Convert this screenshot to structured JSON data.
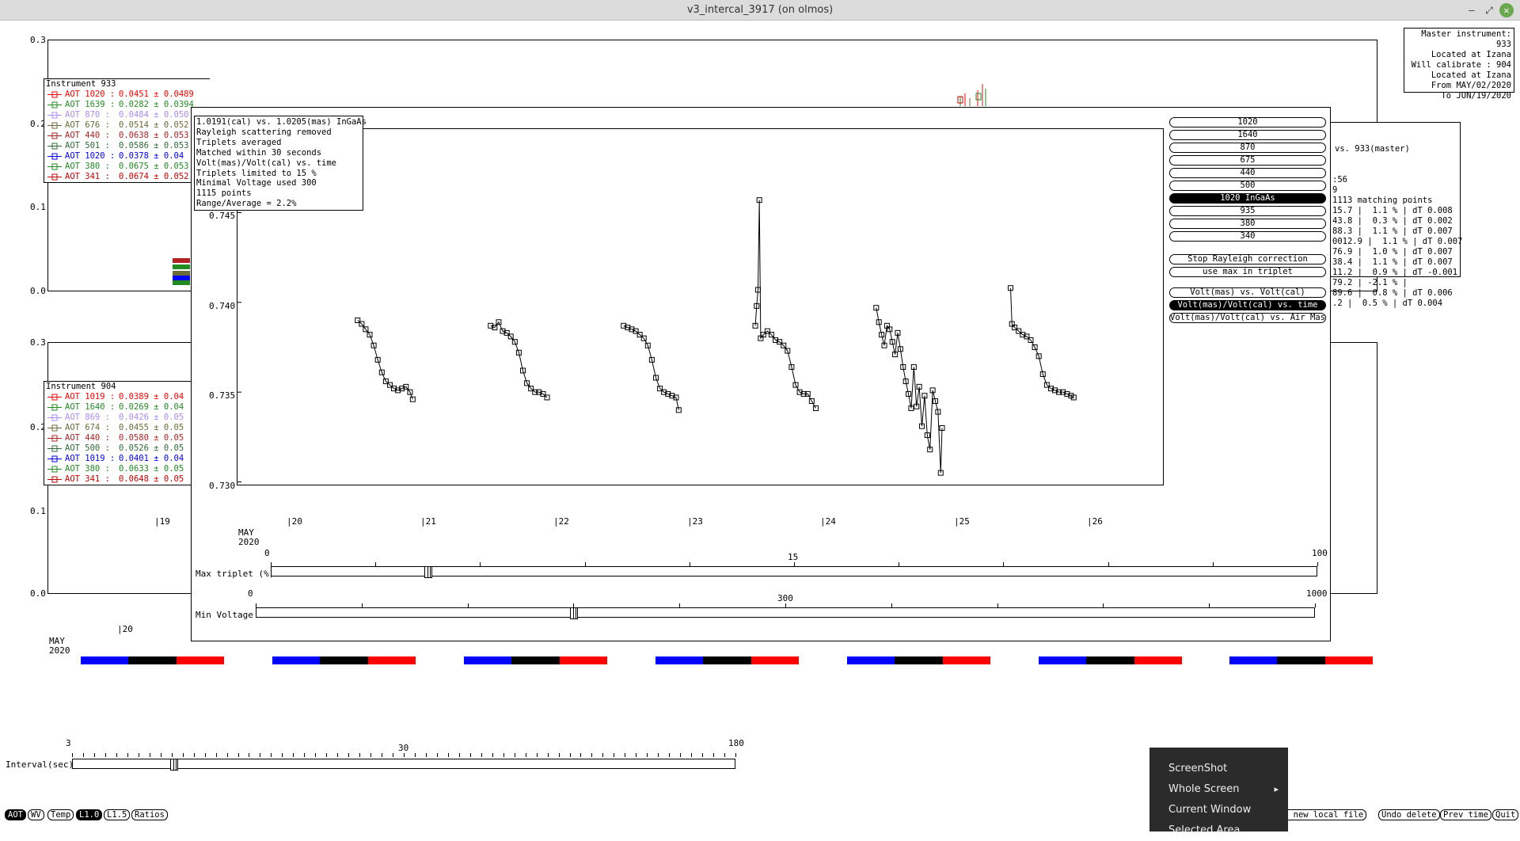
{
  "window": {
    "title": "v3_intercal_3917 (on olmos)",
    "minimize": "–",
    "maximize": "⤢",
    "close": "✕"
  },
  "master_info": [
    "Master instrument: 933",
    "Located at Izana",
    "Will calibrate   : 904",
    "Located at Izana",
    "From MAY/02/2020",
    "To JUN/19/2020"
  ],
  "plot_top": {
    "yticks": [
      "0.3",
      "0.2",
      "0.1",
      "0.0"
    ]
  },
  "plot_bottom": {
    "yticks": [
      "0.3",
      "0.2",
      "0.1",
      "0.0"
    ],
    "xtick": "|20",
    "date_month": "MAY",
    "date_year": "2020"
  },
  "legend_933": {
    "title": "Instrument 933",
    "rows": [
      {
        "label": "AOT 1020 :",
        "value": "0.0451 ± 0.0489",
        "color": "#ff0000"
      },
      {
        "label": "AOT 1639 :",
        "value": "0.0282 ± 0.0394",
        "color": "#228b22"
      },
      {
        "label": "AOT 870 :",
        "value": "0.0484 ± 0.050",
        "color": "#a98bff"
      },
      {
        "label": "AOT 676 :",
        "value": "0.0514 ± 0.052",
        "color": "#6b6b3a"
      },
      {
        "label": "AOT 440 :",
        "value": "0.0638 ± 0.053",
        "color": "#b22222"
      },
      {
        "label": "AOT 501 :",
        "value": "0.0586 ± 0.053",
        "color": "#2e6b3a"
      },
      {
        "label": "AOT 1020 :",
        "value": "0.0378 ± 0.04",
        "color": "#0000ff"
      },
      {
        "label": "AOT 380 :",
        "value": "0.0675 ± 0.053",
        "color": "#228b22"
      },
      {
        "label": "AOT 341 :",
        "value": "0.0674 ± 0.052",
        "color": "#cc0000"
      }
    ]
  },
  "legend_904": {
    "title": "Instrument 904",
    "rows": [
      {
        "label": "AOT 1019 :",
        "value": "0.0389 ± 0.04",
        "color": "#ff0000"
      },
      {
        "label": "AOT 1640 :",
        "value": "0.0269 ± 0.04",
        "color": "#228b22"
      },
      {
        "label": "AOT 869 :",
        "value": "0.0426 ± 0.05",
        "color": "#a98bff"
      },
      {
        "label": "AOT 674 :",
        "value": "0.0455 ± 0.05",
        "color": "#6b6b3a"
      },
      {
        "label": "AOT 440 :",
        "value": "0.0580 ± 0.05",
        "color": "#b22222"
      },
      {
        "label": "AOT 500 :",
        "value": "0.0526 ± 0.05",
        "color": "#2e6b3a"
      },
      {
        "label": "AOT 1019 :",
        "value": "0.0401 ± 0.04",
        "color": "#0000ff"
      },
      {
        "label": "AOT 380 :",
        "value": "0.0633 ± 0.05",
        "color": "#228b22"
      },
      {
        "label": "AOT 341 :",
        "value": "0.0648 ± 0.05",
        "color": "#cc0000"
      }
    ]
  },
  "stats_panel": {
    "header": "vs. 933(master)",
    "lines": [
      ":56",
      "9",
      "1113 matching points",
      "15.7 |  1.1 % | dT 0.008",
      "43.8 |  0.3 % | dT 0.002",
      "88.3 |  1.1 % | dT 0.007",
      "0012.9 |  1.1 % | dT 0.007",
      "76.9 |  1.0 % | dT 0.007",
      "38.4 |  1.1 % | dT 0.007",
      "11.2 |  0.9 % | dT -0.001",
      "79.2 | -2.1 % |",
      "89.6 |  0.8 % | dT 0.006",
      ".2 |  0.5 % | dT 0.004"
    ]
  },
  "info_box": [
    "1.0191(cal) vs. 1.0205(mas) InGaAs",
    "Rayleigh scattering removed",
    "Triplets averaged",
    "Matched within 30 seconds",
    "Volt(mas)/Volt(cal) vs. time",
    "Triplets limited to 15 %",
    "Minimal Voltage used 300",
    "1115 points",
    "Range/Average = 2.2%"
  ],
  "wavelength_buttons": [
    {
      "label": "1020",
      "selected": false
    },
    {
      "label": "1640",
      "selected": false
    },
    {
      "label": "870",
      "selected": false
    },
    {
      "label": "675",
      "selected": false
    },
    {
      "label": "440",
      "selected": false
    },
    {
      "label": "500",
      "selected": false
    },
    {
      "label": "1020 InGaAs",
      "selected": true
    },
    {
      "label": "935",
      "selected": false
    },
    {
      "label": "380",
      "selected": false
    },
    {
      "label": "340",
      "selected": false
    }
  ],
  "option_buttons": [
    {
      "label": "Stop Rayleigh correction",
      "selected": false
    },
    {
      "label": "use max in triplet",
      "selected": false
    }
  ],
  "plot_mode_buttons": [
    {
      "label": "Volt(mas) vs. Volt(cal)",
      "selected": false
    },
    {
      "label": "Volt(mas)/Volt(cal) vs. time",
      "selected": true
    },
    {
      "label": "Volt(mas)/Volt(cal) vs. Air Mass",
      "selected": false
    }
  ],
  "chart_data": {
    "type": "scatter",
    "title": "",
    "xlabel": "",
    "ylabel": "",
    "y_tick_labels": [
      "0.745",
      "0.740",
      "0.735",
      "0.730"
    ],
    "ylim": [
      0.7298,
      0.7497
    ],
    "x_tick_labels": [
      "|20",
      "|21",
      "|22",
      "|23",
      "|24",
      "|25",
      "|26"
    ],
    "xlim": [
      19.5,
      26.4
    ],
    "date_month": "MAY",
    "date_year": "2020",
    "grid": false,
    "legend": "none",
    "marker": "square",
    "series": [
      {
        "x": [
          20.4,
          20.43,
          20.46,
          20.49,
          20.52,
          20.55,
          20.58,
          20.61,
          20.64,
          20.67,
          20.7,
          20.73,
          20.76,
          20.79,
          20.81
        ],
        "y": [
          0.739,
          0.7388,
          0.7385,
          0.7382,
          0.7376,
          0.7368,
          0.7361,
          0.7356,
          0.7354,
          0.7352,
          0.7351,
          0.7352,
          0.7353,
          0.735,
          0.7346
        ]
      },
      {
        "x": [
          21.39,
          21.42,
          21.45,
          21.48,
          21.51,
          21.54,
          21.57,
          21.6,
          21.63,
          21.66,
          21.69,
          21.72,
          21.75,
          21.78,
          21.81
        ],
        "y": [
          0.7387,
          0.7386,
          0.7389,
          0.7384,
          0.7383,
          0.7381,
          0.7378,
          0.7372,
          0.7362,
          0.7355,
          0.7352,
          0.735,
          0.735,
          0.7349,
          0.7347
        ]
      },
      {
        "x": [
          22.38,
          22.41,
          22.44,
          22.47,
          22.5,
          22.53,
          22.56,
          22.59,
          22.62,
          22.65,
          22.68,
          22.71,
          22.74,
          22.77,
          22.79
        ],
        "y": [
          0.7387,
          0.7386,
          0.7385,
          0.7384,
          0.7382,
          0.738,
          0.7376,
          0.7368,
          0.7358,
          0.7352,
          0.735,
          0.7349,
          0.7348,
          0.7347,
          0.734
        ]
      },
      {
        "x": [
          23.36,
          23.37,
          23.38,
          23.39,
          23.4,
          23.42,
          23.45,
          23.48,
          23.51,
          23.54,
          23.57,
          23.6,
          23.63,
          23.66,
          23.69,
          23.72,
          23.75,
          23.78,
          23.81
        ],
        "y": [
          0.7387,
          0.7398,
          0.7407,
          0.7457,
          0.738,
          0.7382,
          0.7384,
          0.7382,
          0.7379,
          0.7378,
          0.7376,
          0.7373,
          0.7364,
          0.7354,
          0.735,
          0.7349,
          0.7349,
          0.7345,
          0.7341
        ]
      },
      {
        "x": [
          24.26,
          24.28,
          24.3,
          24.32,
          24.34,
          24.36,
          24.38,
          24.4,
          24.42,
          24.44,
          24.46,
          24.48,
          24.5,
          24.52,
          24.54,
          24.56,
          24.58,
          24.6,
          24.62,
          24.64,
          24.66,
          24.68,
          24.7,
          24.72,
          24.74,
          24.75
        ],
        "y": [
          0.7397,
          0.7389,
          0.7382,
          0.7376,
          0.7387,
          0.7385,
          0.7378,
          0.7371,
          0.7383,
          0.7374,
          0.7364,
          0.7356,
          0.7349,
          0.7341,
          0.7364,
          0.7342,
          0.7353,
          0.7331,
          0.7348,
          0.7326,
          0.7318,
          0.7351,
          0.7345,
          0.7339,
          0.7305,
          0.733
        ]
      },
      {
        "x": [
          25.26,
          25.27,
          25.29,
          25.32,
          25.35,
          25.38,
          25.41,
          25.44,
          25.47,
          25.5,
          25.53,
          25.56,
          25.59,
          25.62,
          25.65,
          25.68,
          25.71,
          25.73
        ],
        "y": [
          0.7408,
          0.7388,
          0.7386,
          0.7384,
          0.7382,
          0.7381,
          0.7379,
          0.7375,
          0.737,
          0.736,
          0.7354,
          0.7352,
          0.7351,
          0.735,
          0.735,
          0.7349,
          0.7348,
          0.7347
        ]
      }
    ]
  },
  "max_triplet": {
    "label": "Max triplet (%)",
    "min": "0",
    "value": "15",
    "max": "100",
    "fraction": 0.15
  },
  "min_voltage": {
    "label": "Min Voltage",
    "min": "0",
    "value": "300",
    "max": "1000",
    "fraction": 0.3
  },
  "interval": {
    "label": "Interval(sec)",
    "min": "3",
    "value": "30",
    "max": "180",
    "fraction": 0.153
  },
  "mid_xticks": {
    "19": "|19"
  },
  "bottom_buttons_left": [
    {
      "label": "AOT",
      "selected": true
    },
    {
      "label": "WV",
      "selected": false
    },
    {
      "label": "Temp",
      "selected": false
    },
    {
      "label": "L1.0",
      "selected": true
    },
    {
      "label": "L1.5",
      "selected": false
    },
    {
      "label": "Ratios",
      "selected": false
    }
  ],
  "bottom_buttons_right": [
    {
      "label": "t new local file",
      "selected": false
    },
    {
      "label": "Undo delete",
      "selected": false
    },
    {
      "label": "Prev time",
      "selected": false
    },
    {
      "label": "Quit",
      "selected": false
    }
  ],
  "context_menu": {
    "items": [
      "ScreenShot",
      "Whole Screen",
      "Current Window",
      "Selected Area"
    ],
    "submenu_arrow": "▸"
  },
  "colors": {
    "blue": "#0000ff",
    "black": "#000000",
    "red": "#ff0000"
  }
}
